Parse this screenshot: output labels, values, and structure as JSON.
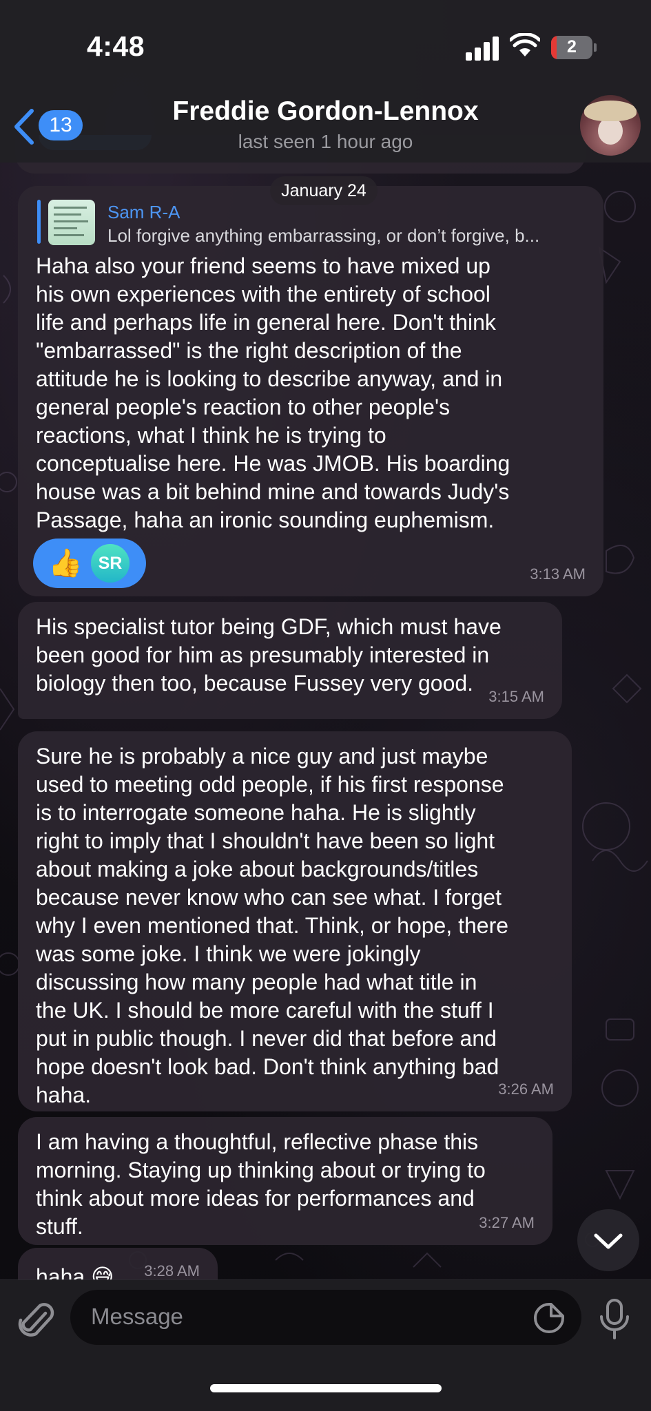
{
  "status_bar": {
    "time": "4:48",
    "battery": "2"
  },
  "header": {
    "back_count": "13",
    "name": "Freddie Gordon-Lennox",
    "status": "last seen 1 hour ago"
  },
  "date_separator": "January 24",
  "messages": [
    {
      "reply": {
        "name": "Sam R-A",
        "text": "Lol forgive anything embarrassing, or don’t forgive, b..."
      },
      "text": "Haha also your friend seems to have mixed up\nhis own experiences with the entirety of school\nlife and perhaps life in general here. Don't think\n\"embarrassed\" is the right description of the\nattitude he is looking to describe anyway, and in\ngeneral people's reaction to other people's\nreactions, what I think he is trying to\nconceptualise here. He was JMOB. His boarding\nhouse was a bit behind mine and towards Judy's\nPassage, haha an ironic sounding euphemism.",
      "reaction": {
        "emoji": "👍",
        "initials": "SR"
      },
      "time": "3:13 AM"
    },
    {
      "text": "His specialist tutor being GDF, which must have\nbeen good for him as presumably interested in\nbiology then too, because Fussey very good.",
      "time": "3:15 AM"
    },
    {
      "text": "Sure he is probably a nice guy and just maybe\nused to meeting odd people, if his first response\nis to interrogate someone haha. He is slightly\nright to imply that I shouldn't have been so light\nabout making a joke about backgrounds/titles\nbecause never know who can see what. I forget\nwhy I even mentioned that. Think, or hope, there\nwas some joke. I think we were jokingly\ndiscussing how many people had what title in\nthe UK. I should be more careful with the stuff I\nput in public though. I never did that before and\nhope doesn't look bad. Don't think anything bad\nhaha.",
      "time": "3:26 AM"
    },
    {
      "text": "I am having a thoughtful, reflective phase this\nmorning. Staying up thinking about or trying to\nthink about more ideas for performances and\nstuff.",
      "time": "3:27 AM"
    },
    {
      "text": "haha 😅",
      "time": "3:28 AM"
    }
  ],
  "composer": {
    "placeholder": "Message"
  },
  "colors": {
    "accent": "#3e8ef7",
    "bubble": "#2c2630",
    "header": "#212024"
  },
  "icons": [
    "back-chevron-icon",
    "signal-icon",
    "wifi-icon",
    "battery-icon",
    "attach-icon",
    "sticker-icon",
    "mic-icon",
    "scroll-down-icon"
  ]
}
